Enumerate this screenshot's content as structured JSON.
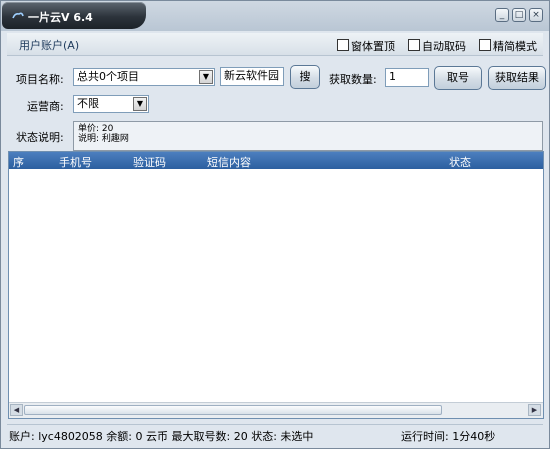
{
  "window": {
    "title": "一片云V 6.4"
  },
  "title_buttons": {
    "minimize": "_",
    "restore": "□",
    "close": "×"
  },
  "menu": {
    "account": "用户账户(A)"
  },
  "options": {
    "topmost": "窗体置顶",
    "auto_fetch": "自动取码",
    "simple_mode": "精简模式"
  },
  "project": {
    "label": "项目名称:",
    "selected": "总共0个项目",
    "search_value": "新云软件园",
    "search_button": "搜"
  },
  "fetch": {
    "label": "获取数量:",
    "quantity": "1",
    "fetch_button": "取号",
    "result_button": "获取结果"
  },
  "carrier": {
    "label": "运营商:",
    "selected": "不限"
  },
  "status_desc": {
    "label": "状态说明:",
    "line1": "单价: 20",
    "line2": "说明: 利趣网"
  },
  "table": {
    "columns": [
      "序",
      "手机号",
      "验证码",
      "短信内容",
      "状态"
    ],
    "rows": []
  },
  "statusbar": {
    "account": "账户:   lyc4802058  余额:  0 云币  最大取号数:  20  状态:  未选中",
    "runtime": "运行时间:  1分40秒"
  }
}
